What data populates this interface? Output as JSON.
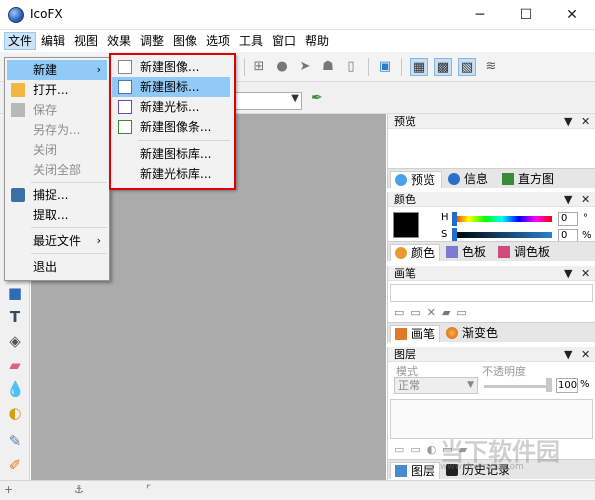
{
  "window": {
    "title": "IcoFX",
    "minimize": "─",
    "maximize": "☐",
    "close": "✕"
  },
  "menubar": [
    "文件",
    "编辑",
    "视图",
    "效果",
    "调整",
    "图像",
    "选项",
    "工具",
    "窗口",
    "帮助"
  ],
  "file_menu": {
    "items": [
      {
        "label": "新建",
        "submenu": true,
        "highlighted": true
      },
      {
        "label": "打开...",
        "icon": "folder-icon"
      },
      {
        "label": "保存",
        "disabled": true,
        "icon": "save-icon"
      },
      {
        "label": "另存为...",
        "disabled": true
      },
      {
        "label": "关闭",
        "disabled": true
      },
      {
        "label": "关闭全部",
        "disabled": true
      },
      {
        "label": "捕捉...",
        "icon": "camera-icon"
      },
      {
        "label": "提取..."
      },
      {
        "label": "最近文件",
        "submenu": true
      },
      {
        "label": "退出"
      }
    ]
  },
  "new_submenu": {
    "items": [
      "新建图像...",
      "新建图标...",
      "新建光标...",
      "新建图像条...",
      "新建图标库...",
      "新建光标库..."
    ],
    "highlighted_index": 1
  },
  "panels": {
    "preview": {
      "title": "预览",
      "tabs": [
        "预览",
        "信息",
        "直方图"
      ]
    },
    "colors": {
      "title": "颜色",
      "h_label": "H",
      "s_label": "S",
      "h_value": "0",
      "s_value": "0",
      "unit": "%",
      "tabs": [
        "颜色",
        "色板",
        "调色板"
      ]
    },
    "brush": {
      "title": "画笔",
      "tabs": [
        "画笔",
        "渐变色"
      ]
    },
    "layers": {
      "title": "图层",
      "mode_label": "模式",
      "mode_value": "正常",
      "opacity_label": "不透明度",
      "opacity_value": "100",
      "opacity_unit": "%",
      "tabs": [
        "图层",
        "历史记录"
      ]
    }
  },
  "panel_buttons": {
    "pin": "▼",
    "close": "✕"
  },
  "watermark": {
    "text": "当下软件园",
    "sub": "www.downxia.com"
  },
  "colors_accent": {
    "highlight": "#91c9f7",
    "redbox": "#e00000",
    "canvas": "#ababab"
  }
}
